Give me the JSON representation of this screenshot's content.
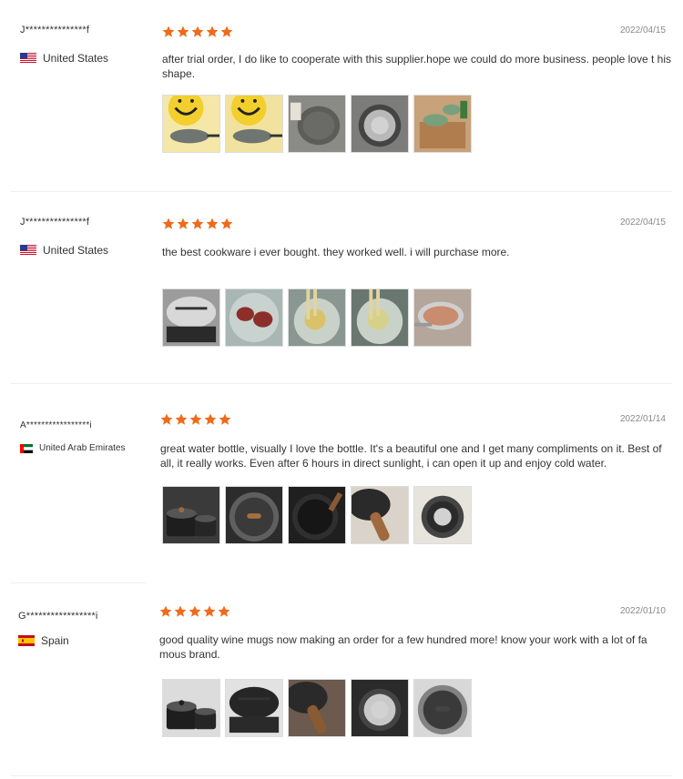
{
  "reviews": [
    {
      "reviewer": "J***************f",
      "country": "United States",
      "flag": "us",
      "rating": 5,
      "date": "2022/04/15",
      "text": "after trial order, I do like to cooperate with this supplier.hope we could do more business. people love t his shape.",
      "images": [
        {
          "bg": "#f4e7a8",
          "accent": "#e8c635",
          "icon": "smiley-pan-photo"
        },
        {
          "bg": "#f1e2a0",
          "accent": "#555555",
          "icon": "smiley-pan-photo"
        },
        {
          "bg": "#8a8a86",
          "accent": "#5c5c58",
          "icon": "pan-photo"
        },
        {
          "bg": "#7c7c7a",
          "accent": "#b9b9b9",
          "icon": "pan-bottom-photo"
        },
        {
          "bg": "#c7a27a",
          "accent": "#78a07c",
          "icon": "cookware-set-photo"
        }
      ]
    },
    {
      "reviewer": "J***************f",
      "country": "United States",
      "flag": "us",
      "rating": 5,
      "date": "2022/04/15",
      "text": "the best cookware i ever bought. they worked well. i will purchase more.",
      "images": [
        {
          "bg": "#9c9c9c",
          "accent": "#d8d8d8",
          "icon": "lidded-pot-photo"
        },
        {
          "bg": "#a9b7b4",
          "accent": "#8c2f2a",
          "icon": "steak-pan-photo"
        },
        {
          "bg": "#8a9691",
          "accent": "#d9c26a",
          "icon": "cooking-pan-photo"
        },
        {
          "bg": "#6a7670",
          "accent": "#d6d18a",
          "icon": "cooking-pan-photo"
        },
        {
          "bg": "#b4a69b",
          "accent": "#c98c6f",
          "icon": "boiling-pot-photo"
        }
      ]
    },
    {
      "reviewer": "A*****************i",
      "country": "United Arab Emirates",
      "flag": "ae",
      "rating": 5,
      "date": "2022/01/14",
      "text": "great water bottle, visually I love the bottle. It's a beautiful one and I get many compliments on it. Best of all, it really works. Even after 6 hours in direct sunlight, i can open it up and enjoy cold water.",
      "images": [
        {
          "bg": "#3a3a3a",
          "accent": "#9a6a42",
          "icon": "pot-set-photo"
        },
        {
          "bg": "#2c2c2c",
          "accent": "#a4703f",
          "icon": "glass-lid-photo"
        },
        {
          "bg": "#1f1f1f",
          "accent": "#3a3a3a",
          "icon": "frying-pan-photo"
        },
        {
          "bg": "#d9d3c9",
          "accent": "#a06a3e",
          "icon": "pan-handle-photo"
        },
        {
          "bg": "#e7e4de",
          "accent": "#2b2b2b",
          "icon": "pan-bottom-photo"
        }
      ]
    },
    {
      "reviewer": "G*****************i",
      "country": "Spain",
      "flag": "es",
      "rating": 5,
      "date": "2022/01/10",
      "text": "good quality wine mugs now making an order for a few hundred more! know your work with a lot of fa mous brand.",
      "images": [
        {
          "bg": "#dcdcdc",
          "accent": "#1f1f1f",
          "icon": "pot-set-photo"
        },
        {
          "bg": "#e2e2e2",
          "accent": "#262626",
          "icon": "lidded-pot-photo"
        },
        {
          "bg": "#6b5a4d",
          "accent": "#8a5a34",
          "icon": "pan-handle-photo"
        },
        {
          "bg": "#2a2a2a",
          "accent": "#c9c9c9",
          "icon": "pan-bottom-photo"
        },
        {
          "bg": "#d8d8d8",
          "accent": "#444444",
          "icon": "glass-lid-photo"
        }
      ]
    }
  ],
  "colors": {
    "star": "#f06a1c",
    "divider": "#eeeeee",
    "date": "#888888"
  }
}
